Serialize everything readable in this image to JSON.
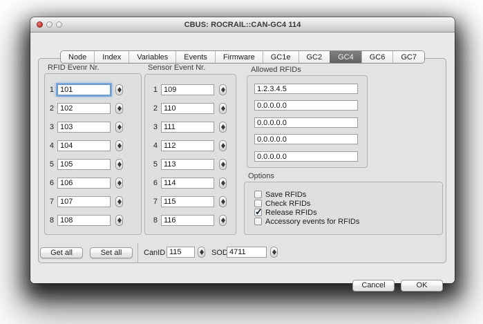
{
  "window": {
    "title": "CBUS: ROCRAIL::CAN-GC4 114"
  },
  "tabs": {
    "items": [
      {
        "label": "Node",
        "selected": false
      },
      {
        "label": "Index",
        "selected": false
      },
      {
        "label": "Variables",
        "selected": false
      },
      {
        "label": "Events",
        "selected": false
      },
      {
        "label": "Firmware",
        "selected": false
      },
      {
        "label": "GC1e",
        "selected": false
      },
      {
        "label": "GC2",
        "selected": false
      },
      {
        "label": "GC4",
        "selected": true
      },
      {
        "label": "GC6",
        "selected": false
      },
      {
        "label": "GC7",
        "selected": false
      }
    ]
  },
  "rfid_group": {
    "label": "RFID Evenr Nr.",
    "rows": [
      {
        "n": "1",
        "value": "101"
      },
      {
        "n": "2",
        "value": "102"
      },
      {
        "n": "3",
        "value": "103"
      },
      {
        "n": "4",
        "value": "104"
      },
      {
        "n": "5",
        "value": "105"
      },
      {
        "n": "6",
        "value": "106"
      },
      {
        "n": "7",
        "value": "107"
      },
      {
        "n": "8",
        "value": "108"
      }
    ]
  },
  "sensor_group": {
    "label": "Sensor Event Nr.",
    "rows": [
      {
        "n": "1",
        "value": "109"
      },
      {
        "n": "2",
        "value": "110"
      },
      {
        "n": "3",
        "value": "111"
      },
      {
        "n": "4",
        "value": "112"
      },
      {
        "n": "5",
        "value": "113"
      },
      {
        "n": "6",
        "value": "114"
      },
      {
        "n": "7",
        "value": "115"
      },
      {
        "n": "8",
        "value": "116"
      }
    ]
  },
  "allowed_group": {
    "label": "Allowed RFIDs",
    "values": [
      "1.2.3.4.5",
      "0.0.0.0.0",
      "0.0.0.0.0",
      "0.0.0.0.0",
      "0.0.0.0.0"
    ]
  },
  "options_group": {
    "label": "Options",
    "checkboxes": [
      {
        "label": "Save RFIDs",
        "checked": false
      },
      {
        "label": "Check RFIDs",
        "checked": false
      },
      {
        "label": "Release RFIDs",
        "checked": true
      },
      {
        "label": "Accessory events for RFIDs",
        "checked": false
      }
    ]
  },
  "controls": {
    "get_all": "Get all",
    "set_all": "Set all",
    "canid": {
      "label": "CanID",
      "value": "115"
    },
    "sod": {
      "label": "SOD",
      "value": "4711"
    }
  },
  "footer": {
    "cancel": "Cancel",
    "ok": "OK"
  },
  "colors": {
    "selected_tab_bg": "#6e6e6e",
    "focus_ring": "#7aa6d8",
    "close_button_red": "#c23b31",
    "window_bg": "#e9e9e9"
  }
}
